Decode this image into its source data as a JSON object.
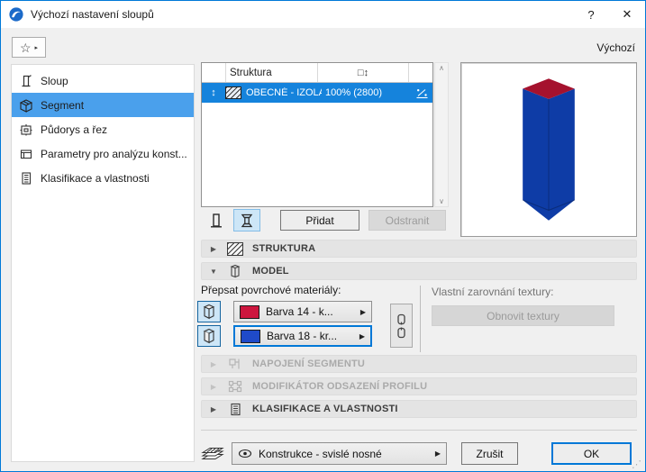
{
  "window": {
    "title": "Výchozí nastavení sloupů",
    "help_label": "?",
    "close_label": "✕"
  },
  "header": {
    "default_label": "Výchozí"
  },
  "icons": {
    "star": "☆",
    "flyout": "▸",
    "scroll_up": "∧",
    "scroll_down": "∨",
    "reorder": "↕",
    "size_col": "□↕",
    "collapsed": "▶",
    "expanded": "▼",
    "dd_arrow": "▶"
  },
  "sidebar": {
    "items": [
      {
        "label": "Sloup"
      },
      {
        "label": "Segment"
      },
      {
        "label": "Půdorys a řez"
      },
      {
        "label": "Parametry pro analýzu konst..."
      },
      {
        "label": "Klasifikace a vlastnosti"
      }
    ],
    "selected_index": 1
  },
  "table": {
    "col_struktura": "Struktura",
    "row": {
      "name": "OBECNÉ - IZOLAČNÍ M...",
      "size": "100% (2800)"
    }
  },
  "segment_buttons": {
    "add": "Přidat",
    "remove": "Odstranit"
  },
  "sections": {
    "struktura": "STRUKTURA",
    "model": "MODEL",
    "napojeni": "NAPOJENÍ SEGMENTU",
    "modifikator": "MODIFIKÁTOR ODSAZENÍ PROFILU",
    "klasifikace": "KLASIFIKACE A VLASTNOSTI"
  },
  "model_panel": {
    "override_label": "Přepsat povrchové materiály:",
    "materials": [
      {
        "label": "Barva 14 - k...",
        "color": "#cd163e"
      },
      {
        "label": "Barva 18 - kr...",
        "color": "#1f4ac9"
      }
    ],
    "texture_label": "Vlastní zarovnání textury:",
    "reset_button": "Obnovit textury"
  },
  "footer": {
    "layer": "Konstrukce - svislé nosné",
    "cancel": "Zrušit",
    "ok": "OK"
  },
  "colors": {
    "accent": "#0078d7",
    "row_selection": "#1583dc",
    "sidebar_selection": "#4aa0ec",
    "preview_blue": "#0e3ca6",
    "preview_top_red": "#a5122e"
  }
}
